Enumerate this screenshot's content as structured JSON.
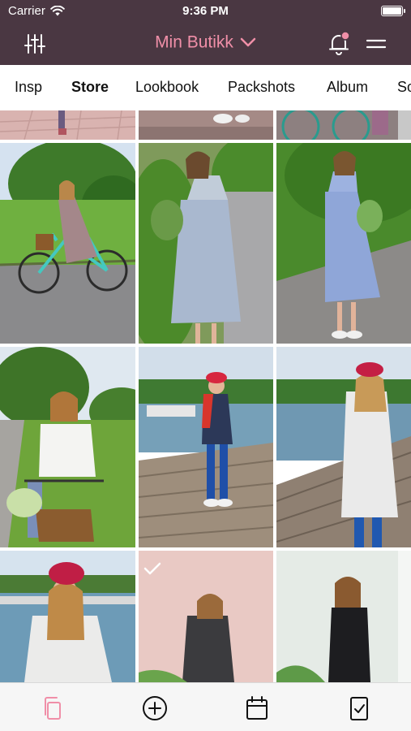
{
  "status_bar": {
    "carrier": "Carrier",
    "time": "9:36 PM"
  },
  "nav": {
    "title": "Min Butikk",
    "notification_dot_color": "#f08fa8",
    "bar_color": "#4a3742"
  },
  "tabs": [
    "Insp",
    "Store",
    "Lookbook",
    "Packshots",
    "Album",
    "So"
  ],
  "active_tab": "Store",
  "grid": {
    "rows": 4,
    "columns": 3,
    "selected_photo": "row-4-col-2",
    "photos": [
      "row-1 partial street photos",
      "woman with green bicycle",
      "woman holding flowers",
      "woman in blue dress on path",
      "woman with bicycle basket",
      "woman in red cap by marina",
      "woman in white jacket on pier",
      "woman in white jacket at harbour",
      "woman in dark dress (selected)",
      "woman in dark dress"
    ]
  },
  "bottom_bar": {
    "items": [
      "copy-icon",
      "add-circle-icon",
      "calendar-icon",
      "checklist-icon"
    ],
    "active_color": "#f08fa8"
  }
}
